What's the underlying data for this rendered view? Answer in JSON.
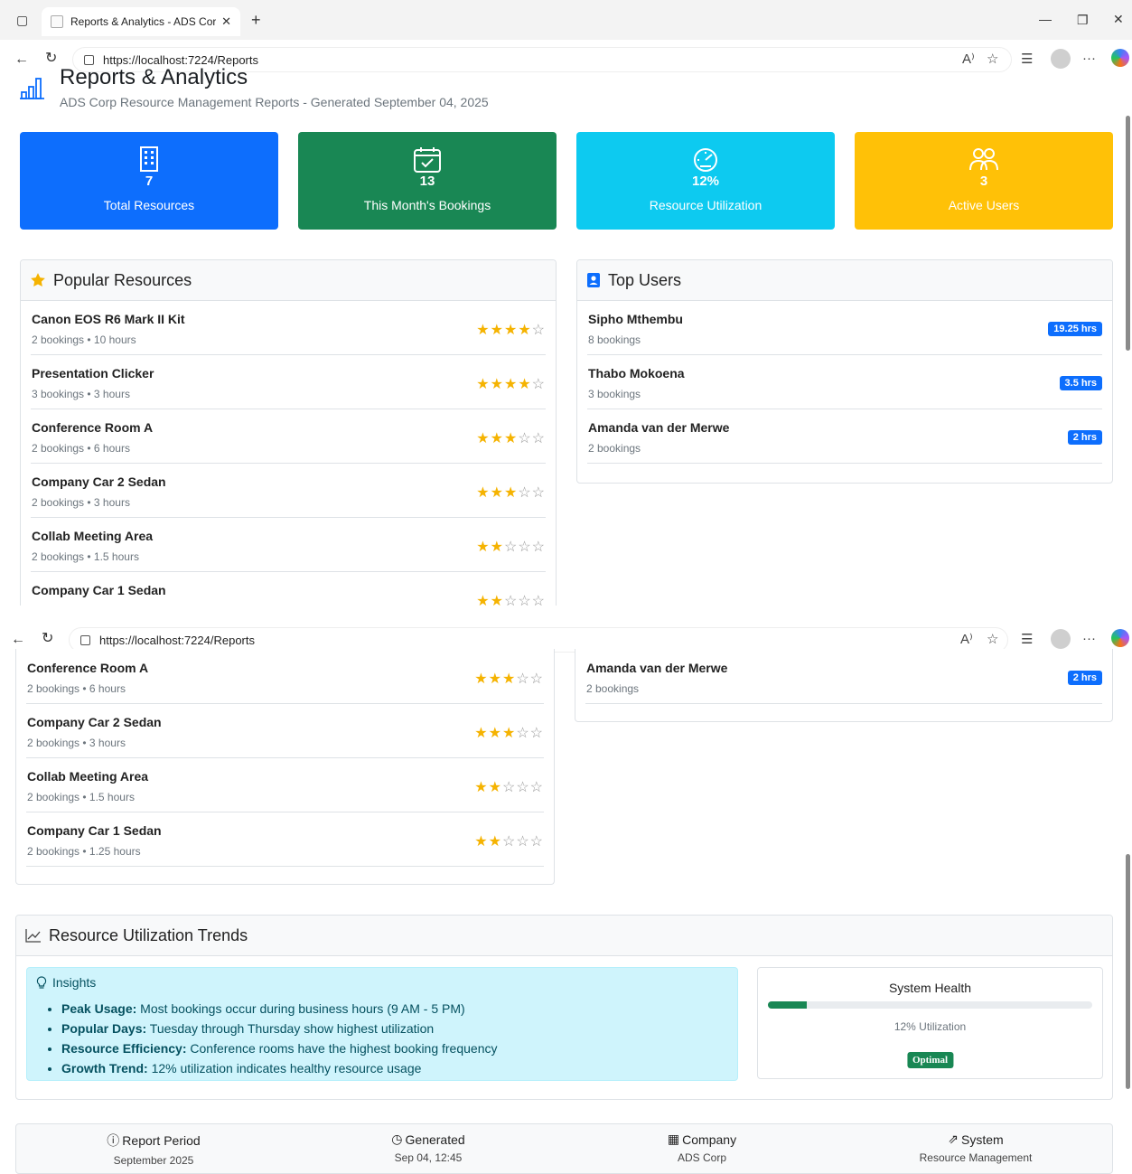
{
  "browser": {
    "tab_title": "Reports & Analytics - ADS Corp R",
    "url": "https://localhost:7224/Reports"
  },
  "page": {
    "title": "Reports & Analytics",
    "subtitle": "ADS Corp Resource Management Reports - Generated September 04, 2025"
  },
  "stats": [
    {
      "value": "7",
      "label": "Total Resources",
      "color": "#0d6efd",
      "icon": "building-icon"
    },
    {
      "value": "13",
      "label": "This Month's Bookings",
      "color": "#198754",
      "icon": "calendar-check-icon"
    },
    {
      "value": "12%",
      "label": "Resource Utilization",
      "color": "#0dcaf0",
      "icon": "speedometer-icon"
    },
    {
      "value": "3",
      "label": "Active Users",
      "color": "#ffc107",
      "icon": "people-icon"
    }
  ],
  "popular_resources": {
    "title": "Popular Resources",
    "items": [
      {
        "name": "Canon EOS R6 Mark II Kit",
        "meta": "2 bookings • 10 hours",
        "rating": 4
      },
      {
        "name": "Presentation Clicker",
        "meta": "3 bookings • 3 hours",
        "rating": 4
      },
      {
        "name": "Conference Room A",
        "meta": "2 bookings • 6 hours",
        "rating": 3
      },
      {
        "name": "Company Car 2 Sedan",
        "meta": "2 bookings • 3 hours",
        "rating": 3
      },
      {
        "name": "Collab Meeting Area",
        "meta": "2 bookings • 1.5 hours",
        "rating": 2
      },
      {
        "name": "Company Car 1 Sedan",
        "meta": "2 bookings • 1.25 hours",
        "rating": 2
      }
    ]
  },
  "top_users": {
    "title": "Top Users",
    "items": [
      {
        "name": "Sipho Mthembu",
        "meta": "8 bookings",
        "hours": "19.25 hrs"
      },
      {
        "name": "Thabo Mokoena",
        "meta": "3 bookings",
        "hours": "3.5 hrs"
      },
      {
        "name": "Amanda van der Merwe",
        "meta": "2 bookings",
        "hours": "2 hrs"
      }
    ]
  },
  "trends": {
    "title": "Resource Utilization Trends",
    "insights_title": "Insights",
    "insights": [
      {
        "label": "Peak Usage:",
        "text": "Most bookings occur during business hours (9 AM - 5 PM)"
      },
      {
        "label": "Popular Days:",
        "text": "Tuesday through Thursday show highest utilization"
      },
      {
        "label": "Resource Efficiency:",
        "text": "Conference rooms have the highest booking frequency"
      },
      {
        "label": "Growth Trend:",
        "text": "12% utilization indicates healthy resource usage"
      }
    ],
    "health": {
      "title": "System Health",
      "utilization_text": "12% Utilization",
      "utilization_fraction": 0.12,
      "status": "Optimal"
    }
  },
  "footer": [
    {
      "title": "Report Period",
      "value": "September 2025",
      "icon": "info-icon"
    },
    {
      "title": "Generated",
      "value": "Sep 04, 12:45",
      "icon": "clock-icon"
    },
    {
      "title": "Company",
      "value": "ADS Corp",
      "icon": "building-icon"
    },
    {
      "title": "System",
      "value": "Resource Management",
      "icon": "graph-up-icon"
    }
  ]
}
